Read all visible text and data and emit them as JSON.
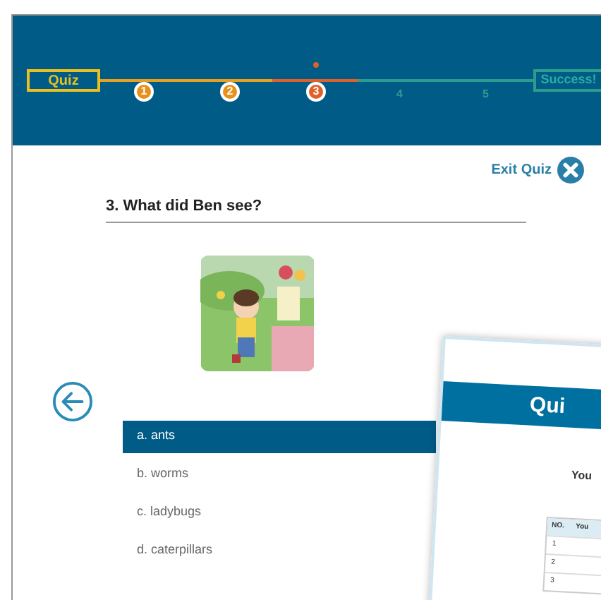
{
  "progress": {
    "start": "Quiz",
    "end": "Success!",
    "steps": [
      {
        "label": "1",
        "kind": "done"
      },
      {
        "label": "2",
        "kind": "done"
      },
      {
        "label": "3",
        "kind": "current"
      },
      {
        "label": "4",
        "kind": "upcoming"
      },
      {
        "label": "5",
        "kind": "upcoming"
      }
    ]
  },
  "exit": {
    "label": "Exit Quiz"
  },
  "question": {
    "text": "3. What did Ben see?"
  },
  "answers": [
    {
      "label": "a. ants",
      "selected": true
    },
    {
      "label": "b. worms",
      "selected": false
    },
    {
      "label": "c. ladybugs",
      "selected": false
    },
    {
      "label": "d. caterpillars",
      "selected": false
    }
  ],
  "overlay_page": {
    "title": "Qui",
    "heading": "You",
    "table": {
      "columns": [
        "NO.",
        "You"
      ],
      "rows": [
        "1",
        "2",
        "3"
      ]
    }
  }
}
